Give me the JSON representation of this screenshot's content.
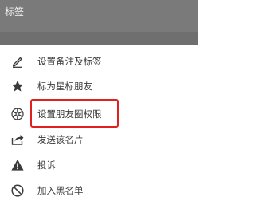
{
  "header": {
    "title": "标签"
  },
  "menu": {
    "items": [
      {
        "label": "设置备注及标签",
        "icon": "pencil-icon"
      },
      {
        "label": "标为星标朋友",
        "icon": "star-icon"
      },
      {
        "label": "设置朋友圈权限",
        "icon": "moments-aperture-icon",
        "highlighted": true
      },
      {
        "label": "发送该名片",
        "icon": "share-icon"
      },
      {
        "label": "投诉",
        "icon": "warning-icon"
      },
      {
        "label": "加入黑名单",
        "icon": "block-icon"
      }
    ]
  },
  "colors": {
    "header_background": "#7a7a7a",
    "highlight_border": "#e0201c",
    "icon": "#3a3a3a",
    "text": "#3a3a3a"
  }
}
